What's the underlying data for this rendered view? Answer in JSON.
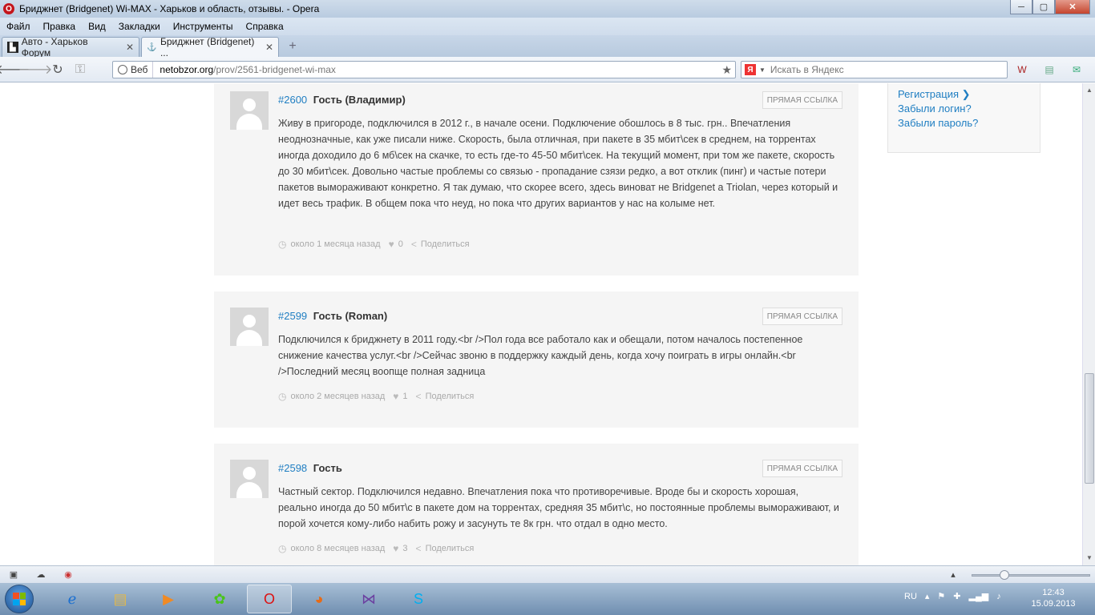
{
  "window": {
    "title": "Бриджнет (Bridgenet) Wi-MAX - Харьков и область, отзывы. - Opera",
    "minimize": "─",
    "maximize": "▢",
    "close": "✕"
  },
  "menu": [
    "Файл",
    "Правка",
    "Вид",
    "Закладки",
    "Инструменты",
    "Справка"
  ],
  "tabs": [
    {
      "label": "Авто - Харьков Форум",
      "active": false
    },
    {
      "label": "Бриджнет (Bridgenet) ...",
      "active": true
    }
  ],
  "address": {
    "web_label": "Веб",
    "domain": "netobzor.org",
    "path": "/prov/2561-bridgenet-wi-max"
  },
  "search": {
    "placeholder": "Искать в Яндекс",
    "engine_glyph": "Я"
  },
  "sidebar": {
    "links": [
      "Регистрация ❯",
      "Забыли логин?",
      "Забыли пароль?"
    ]
  },
  "comments": [
    {
      "id": "#2600",
      "author": "Гость (Владимир)",
      "permalink": "Прямая ссылка",
      "text": "Живу в пригороде, подключился в 2012 г., в начале осени. Подключение обошлось в 8 тыс. грн.. Впечатления неоднозначные, как уже писали ниже. Скорость, была отличная, при пакете в 35 мбит\\сек в среднем, на торрентах иногда доходило до 6 мб\\сек на скачке, то есть где-то 45-50 мбит\\сек. На текущий момент, при том же пакете, скорость до 30 мбит\\сек. Довольно частые проблемы со связью - пропадание сзязи редко, а вот отклик (пинг) и частые потери пакетов вымораживают конкретно. Я так думаю, что скорее всего, здесь виноват не Bridgenet а Triolan, через который и идет весь трафик. В общем пока что неуд, но пока что других вариантов у нас на колыме нет.",
      "time": "около 1 месяца назад",
      "likes": "0",
      "share": "Поделиться"
    },
    {
      "id": "#2599",
      "author": "Гость (Roman)",
      "permalink": "Прямая ссылка",
      "text": "Подключился к бриджнету в 2011 году.<br />Пол года все работало как и обещали, потом началось постепенное снижение качества услуг.<br />Сейчас звоню в поддержку каждый день, когда хочу поиграть в игры онлайн.<br />Последний месяц воопще полная задница",
      "time": "около 2 месяцев назад",
      "likes": "1",
      "share": "Поделиться"
    },
    {
      "id": "#2598",
      "author": "Гость",
      "permalink": "Прямая ссылка",
      "text": "Частный сектор. Подключился недавно. Впечатления пока что противоречивые. Вроде бы и скорость хорошая, реально иногда до 50 мбит\\с в пакете дом на торрентах, средняя 35 мбит\\с, но постоянные проблемы вымораживают, и порой хочется кому-либо набить рожу и засунуть те 8к грн. что отдал в одно место.",
      "time": "около 8 месяцев назад",
      "likes": "3",
      "share": "Поделиться"
    }
  ],
  "taskbar": {
    "lang": "RU",
    "time": "12:43",
    "date": "15.09.2013"
  },
  "colors": {
    "link": "#1f7ec2",
    "comment_bg": "#f5f5f5",
    "opera_red": "#c4161c"
  }
}
